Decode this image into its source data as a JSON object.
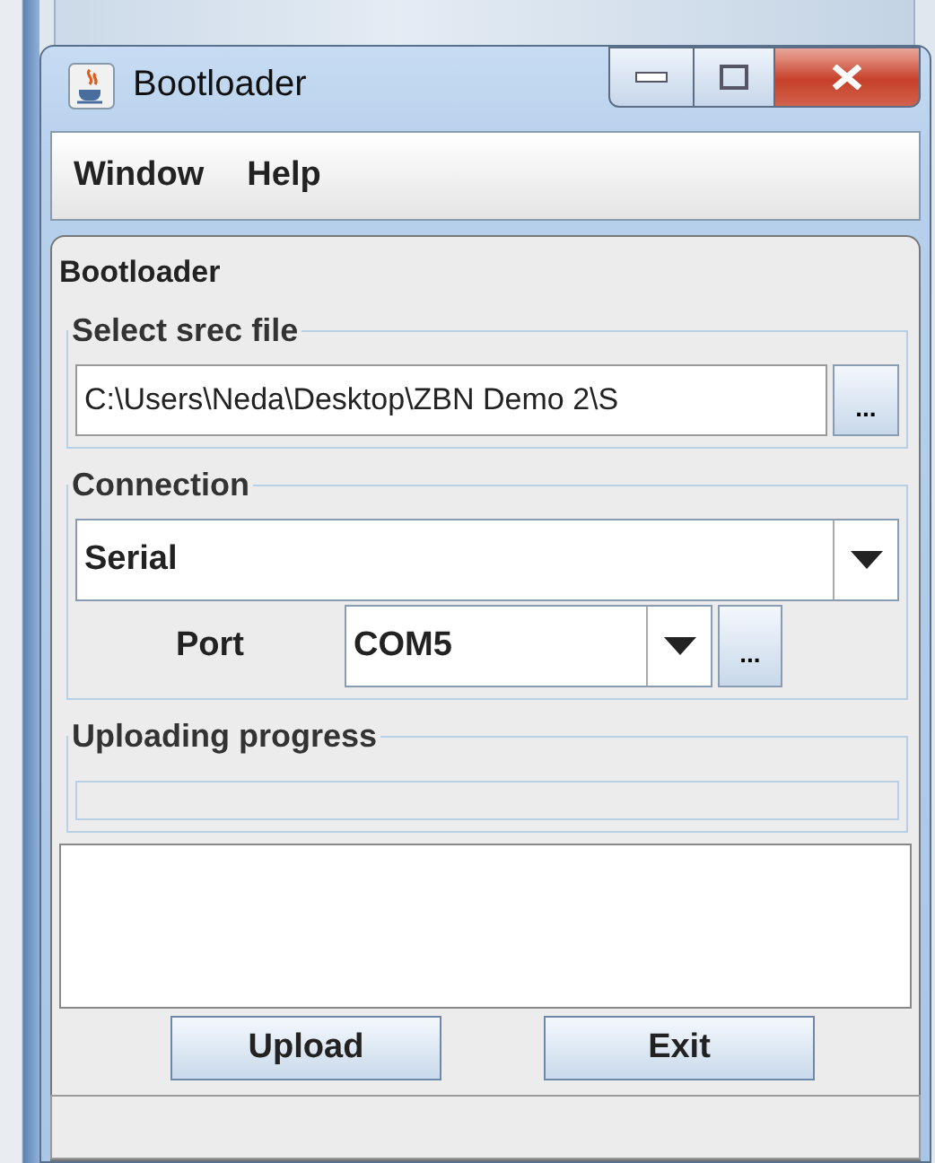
{
  "window": {
    "title": "Bootloader"
  },
  "menu": [
    {
      "label": "Window"
    },
    {
      "label": "Help"
    }
  ],
  "panel_title": "Bootloader",
  "file_group": {
    "legend": "Select srec file",
    "path": "C:\\Users\\Neda\\Desktop\\ZBN Demo 2\\S",
    "browse": "..."
  },
  "connection": {
    "legend": "Connection",
    "type": "Serial",
    "port_label": "Port",
    "port": "COM5",
    "browse": "..."
  },
  "progress": {
    "legend": "Uploading progress",
    "level": 0
  },
  "buttons": [
    {
      "label": "Upload"
    },
    {
      "label": "Exit"
    }
  ]
}
